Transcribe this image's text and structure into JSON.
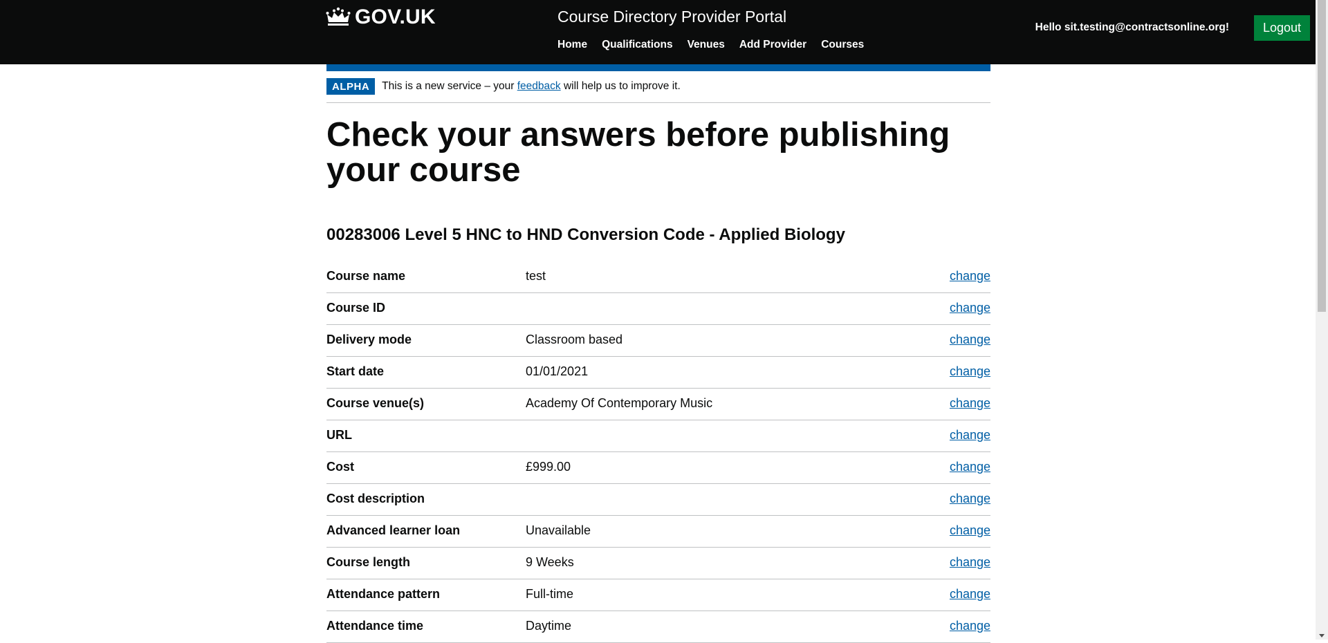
{
  "header": {
    "logo_text": "GOV.UK",
    "service_name": "Course Directory Provider Portal",
    "nav": [
      "Home",
      "Qualifications",
      "Venues",
      "Add Provider",
      "Courses"
    ],
    "greeting": "Hello sit.testing@contractsonline.org!",
    "logout_label": "Logout"
  },
  "phase_banner": {
    "tag": "ALPHA",
    "text_before": "This is a new service – your ",
    "link": "feedback",
    "text_after": " will help us to improve it."
  },
  "page": {
    "title": "Check your answers before publishing your course",
    "subtitle": "00283006 Level 5 HNC to HND Conversion Code - Applied Biology"
  },
  "summary": [
    {
      "key": "Course name",
      "value": "test",
      "action": "change"
    },
    {
      "key": "Course ID",
      "value": "",
      "action": "change"
    },
    {
      "key": "Delivery mode",
      "value": "Classroom based",
      "action": "change"
    },
    {
      "key": "Start date",
      "value": "01/01/2021",
      "action": "change"
    },
    {
      "key": "Course venue(s)",
      "value": "Academy Of Contemporary Music",
      "action": "change"
    },
    {
      "key": "URL",
      "value": "",
      "action": "change"
    },
    {
      "key": "Cost",
      "value": "£999.00",
      "action": "change"
    },
    {
      "key": "Cost description",
      "value": "",
      "action": "change"
    },
    {
      "key": "Advanced learner loan",
      "value": "Unavailable",
      "action": "change"
    },
    {
      "key": "Course length",
      "value": "9 Weeks",
      "action": "change"
    },
    {
      "key": "Attendance pattern",
      "value": "Full-time",
      "action": "change"
    },
    {
      "key": "Attendance time",
      "value": "Daytime",
      "action": "change"
    }
  ],
  "colors": {
    "header_bg": "#0b0c0c",
    "brand_blue": "#005ea5",
    "logout_green": "#00823b",
    "border": "#bfc1c3"
  }
}
